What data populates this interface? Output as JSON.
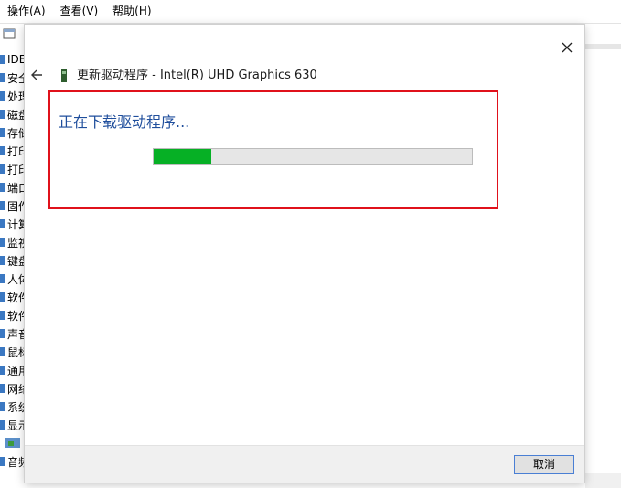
{
  "menubar": {
    "items": [
      "操作(A)",
      "查看(V)",
      "帮助(H)"
    ]
  },
  "toolbar": {
    "icons": [
      "properties-icon",
      "help-icon",
      "scan-icon",
      "monitor-icon",
      "update-driver-icon",
      "uninstall-icon",
      "disable-icon"
    ]
  },
  "tree": {
    "items": [
      "IDE",
      "安全",
      "处理",
      "磁盘",
      "存储",
      "打印",
      "打印",
      "端口",
      "固件",
      "计算",
      "监视",
      "键盘",
      "人体",
      "软件",
      "软件",
      "声音",
      "鼠标",
      "通用",
      "网络",
      "系统",
      "显示",
      "",
      "音频"
    ]
  },
  "dialog": {
    "title": "更新驱动程序 - Intel(R) UHD Graphics 630",
    "status": "正在下载驱动程序...",
    "progress": 0.18,
    "cancel_label": "取消"
  },
  "colors": {
    "progress_fill": "#06b025",
    "highlight": "#e0111b",
    "status_text": "#1f4e9c"
  }
}
